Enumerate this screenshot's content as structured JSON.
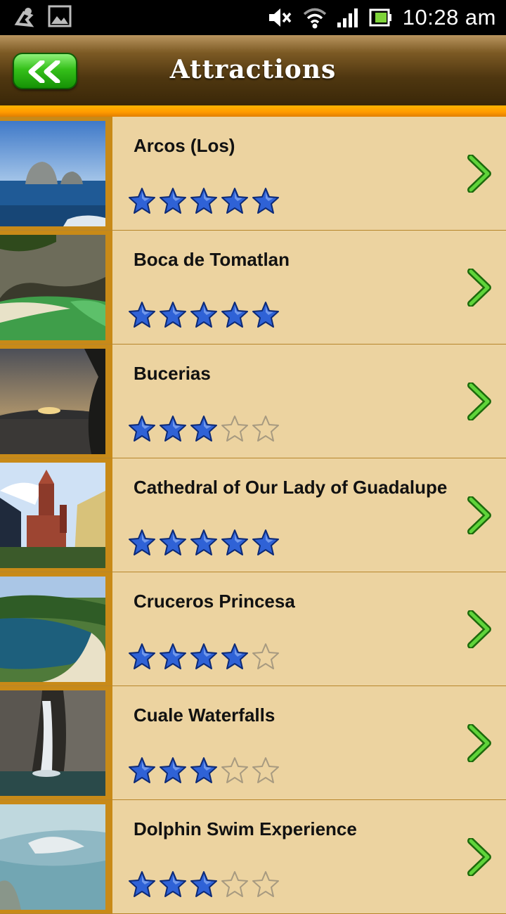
{
  "status_bar": {
    "time": "10:28 am",
    "icons": [
      "usb-debug-icon",
      "image-icon",
      "mute-icon",
      "wifi-icon",
      "signal-icon",
      "battery-icon"
    ]
  },
  "header": {
    "title": "Attractions",
    "back_icon": "double-chevron-left-icon"
  },
  "colors": {
    "background": "#ecd3a0",
    "header_dark": "#3a2708",
    "accent_orange": "#ff9a00",
    "back_green": "#35c01a",
    "star_blue": "#2f62d6",
    "chevron_green": "#3db51b"
  },
  "attractions": [
    {
      "title": "Arcos (Los)",
      "rating": 5,
      "thumb": "rock-arches-sea"
    },
    {
      "title": "Boca de Tomatlan",
      "rating": 5,
      "thumb": "cove-beach"
    },
    {
      "title": "Bucerias",
      "rating": 3,
      "thumb": "sunset-beach"
    },
    {
      "title": "Cathedral of Our Lady of Guadalupe",
      "rating": 5,
      "thumb": "cathedral-tower"
    },
    {
      "title": "Cruceros Princesa",
      "rating": 4,
      "thumb": "bay-aerial"
    },
    {
      "title": "Cuale Waterfalls",
      "rating": 3,
      "thumb": "waterfall"
    },
    {
      "title": "Dolphin Swim Experience",
      "rating": 3,
      "thumb": "dolphin-water"
    }
  ]
}
